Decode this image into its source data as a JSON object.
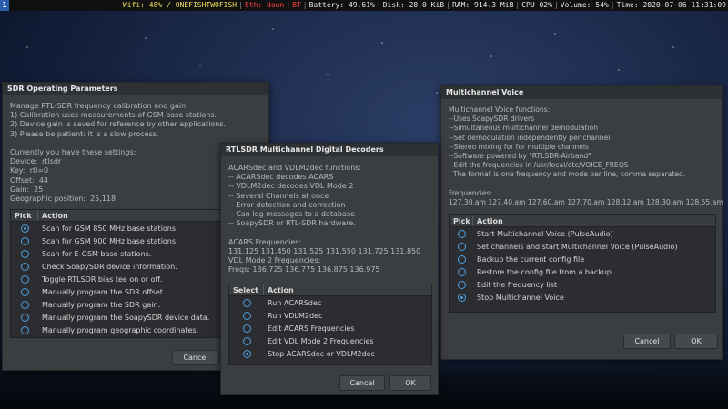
{
  "topbar": {
    "workspace": "1",
    "wifi": "Wifi:  48% / ONEFISHTWOFISH",
    "eth": "Eth: down",
    "bt": "BT",
    "battery": "Battery: 49.61%",
    "disk": "Disk: 28.0 KiB",
    "ram": "RAM: 914.3 MiB",
    "cpu": "CPU 02%",
    "volume": "Volume: 54%",
    "time": "Time: 2020-07-06 11:31:09"
  },
  "sdr": {
    "title": "SDR Operating Parameters",
    "description": "Manage RTL-SDR frequency calibration and gain.\n1) Calibration uses measurements of GSM base stations.\n2) Device gain is saved for reference by other applications.\n3) Please be patient: it is a slow process.\n\nCurrently you have these settings:\nDevice:  rtlsdr\nKey:  rtl=0\nOffset:  44\nGain:  25\nGeographic position:  25,118",
    "col_pick": "Pick",
    "col_action": "Action",
    "items": [
      {
        "label": "Scan for GSM 850 MHz base stations.",
        "selected": true
      },
      {
        "label": "Scan for GSM 900 MHz base stations.",
        "selected": false
      },
      {
        "label": "Scan for E-GSM base stations.",
        "selected": false
      },
      {
        "label": "Check SoapySDR device information.",
        "selected": false
      },
      {
        "label": "Toggle RTLSDR bias tee on or off.",
        "selected": false
      },
      {
        "label": "Manually program the SDR offset.",
        "selected": false
      },
      {
        "label": "Manually program the SDR gain.",
        "selected": false
      },
      {
        "label": "Manually program the SoapySDR device data.",
        "selected": false
      },
      {
        "label": "Manually program geographic coordinates.",
        "selected": false
      }
    ],
    "cancel": "Cancel"
  },
  "rtl": {
    "title": "RTLSDR Multichannel Digital Decoders",
    "description": "ACARSdec and VDLM2dec functions:\n-- ACARSdec decodes ACARS\n-- VDLM2dec decodes VDL Mode 2\n-- Several Channels at once\n-- Error detection and correction\n-- Can log messages to a database\n-- SoapySDR or RTL-SDR hardware.\n\nACARS Frequencies:\n131.125 131.450 131.525 131.550 131.725 131.850\nVDL Mode 2 Frequencies:\nFreqs: 136.725 136.775 136.875 136.975",
    "col_select": "Select",
    "col_action": "Action",
    "items": [
      {
        "label": "Run ACARSdec",
        "selected": false
      },
      {
        "label": "Run VDLM2dec",
        "selected": false
      },
      {
        "label": "Edit ACARS Frequencies",
        "selected": false
      },
      {
        "label": "Edit VDL Mode 2 Frequencies",
        "selected": false
      },
      {
        "label": "Stop ACARSdec or VDLM2dec",
        "selected": true
      }
    ],
    "cancel": "Cancel",
    "ok": "OK"
  },
  "mcv": {
    "title": "Multichannel Voice",
    "description": "Multichannel Voice functions:\n--Uses SoapySDR drivers\n--Simultaneous multichannel demodulation\n--Set demodulation independently per channel\n--Stereo mixing for for multiple channels\n--Software powered by \"RTLSDR-Airband\"\n--Edit the frequencies in /usr/local/etc/VOICE_FREQS\n  The format is one frequency and mode per line, comma separated.\n\nFrequencies:\n127.30,am 127.40,am 127.60,am 127.70,am 128.12,am 128.30,am 128.55,am",
    "col_pick": "Pick",
    "col_action": "Action",
    "items": [
      {
        "label": "Start Multichannel Voice (PulseAudio)",
        "selected": false
      },
      {
        "label": "Set channels and start Multichannel Voice (PulseAudio)",
        "selected": false
      },
      {
        "label": "Backup the current config file",
        "selected": false
      },
      {
        "label": "Restore the config file from a backup",
        "selected": false
      },
      {
        "label": "Edit the frequency list",
        "selected": false
      },
      {
        "label": "Stop Multichannel Voice",
        "selected": true
      }
    ],
    "cancel": "Cancel",
    "ok": "OK"
  }
}
